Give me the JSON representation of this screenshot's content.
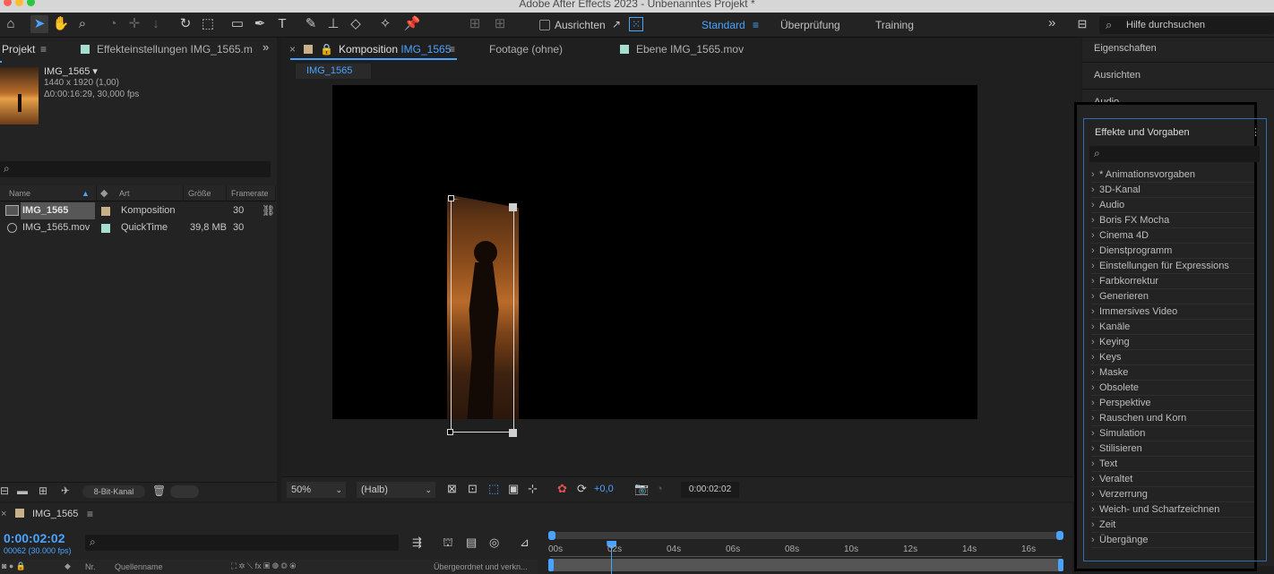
{
  "window": {
    "title": "Adobe After Effects 2023 - Unbenanntes Projekt *"
  },
  "toolbar": {
    "snap_label": "Ausrichten",
    "workspaces": [
      "Standard",
      "Überprüfung",
      "Training"
    ],
    "active_workspace": "Standard",
    "help_search_placeholder": "Hilfe durchsuchen"
  },
  "project": {
    "tab_label": "Projekt",
    "effects_tab_label": "Effekteinstellungen IMG_1565.m",
    "item_name": "IMG_1565",
    "item_dims": "1440 x 1920 (1,00)",
    "item_duration": "Δ0:00:16:29, 30,000 fps",
    "columns": [
      "Name",
      "Art",
      "Größe",
      "Framerate"
    ],
    "rows": [
      {
        "name": "IMG_1565",
        "type": "Komposition",
        "size": "",
        "fps": "30",
        "color": "#c8b089",
        "selected": true
      },
      {
        "name": "IMG_1565.mov",
        "type": "QuickTime",
        "size": "39,8 MB",
        "fps": "30",
        "color": "#a6ddcf",
        "selected": false
      }
    ],
    "bit_depth": "8-Bit-Kanal"
  },
  "viewer": {
    "tabs": [
      {
        "label": "Komposition",
        "name": "IMG_1565",
        "active": true
      },
      {
        "label": "Footage (ohne)",
        "active": false
      },
      {
        "label": "Ebene IMG_1565.mov",
        "active": false
      }
    ],
    "breadcrumb": "IMG_1565",
    "zoom": "50%",
    "resolution": "(Halb)",
    "exposure": "+0,0",
    "timecode": "0:00:02:02"
  },
  "right_panel": {
    "items": [
      "Eigenschaften",
      "Ausrichten",
      "Audio"
    ],
    "effects_title": "Effekte und Vorgaben",
    "categories": [
      "* Animationsvorgaben",
      "3D-Kanal",
      "Audio",
      "Boris FX Mocha",
      "Cinema 4D",
      "Dienstprogramm",
      "Einstellungen für Expressions",
      "Farbkorrektur",
      "Generieren",
      "Immersives Video",
      "Kanäle",
      "Keying",
      "Keys",
      "Maske",
      "Obsolete",
      "Perspektive",
      "Rauschen und Korn",
      "Simulation",
      "Stilisieren",
      "Text",
      "Veraltet",
      "Verzerrung",
      "Weich- und Scharfzeichnen",
      "Zeit",
      "Übergänge"
    ]
  },
  "timeline": {
    "comp_name": "IMG_1565",
    "timecode": "0:00:02:02",
    "frame_info": "00062 (30.000 fps)",
    "columns": {
      "nr": "Nr.",
      "source": "Quellenname",
      "parent": "Übergeordnet und verkn..."
    },
    "ruler": [
      "00s",
      "02s",
      "04s",
      "06s",
      "08s",
      "10s",
      "12s",
      "14s",
      "16s"
    ],
    "playhead_seconds": 2.07,
    "duration_seconds": 17
  },
  "colors": {
    "accent": "#4aa3ff",
    "panel": "#232323",
    "background": "#1d1d1d"
  }
}
